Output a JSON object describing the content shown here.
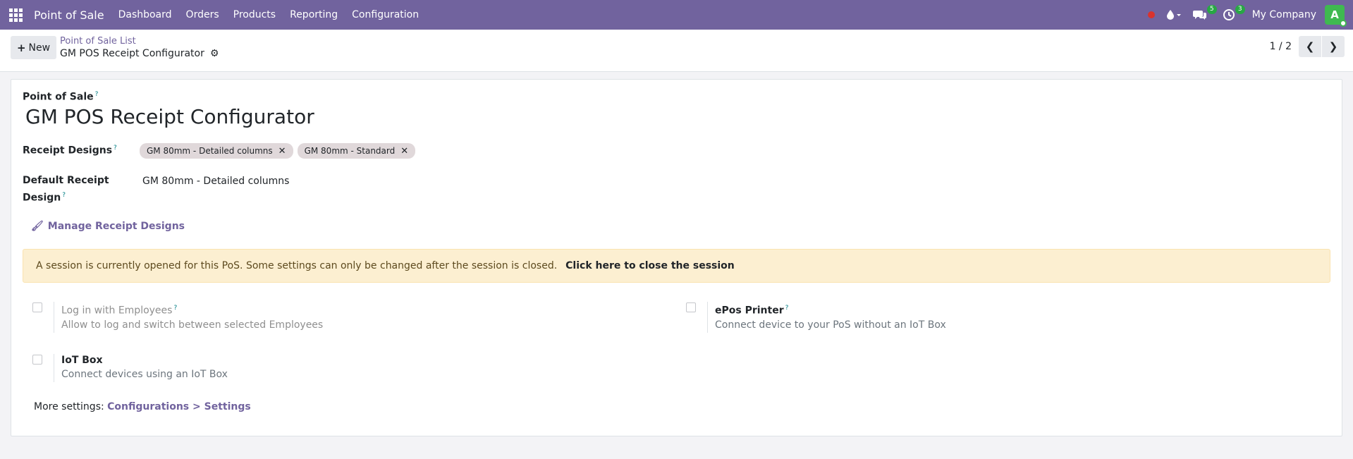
{
  "navbar": {
    "app_title": "Point of Sale",
    "menu": [
      "Dashboard",
      "Orders",
      "Products",
      "Reporting",
      "Configuration"
    ],
    "messages_count": "5",
    "activities_count": "3",
    "company": "My Company",
    "avatar_letter": "A",
    "colors": {
      "navbar_bg": "#71639e",
      "avatar_bg": "#3fb950",
      "badge": "#28a745",
      "record_dot": "#d9332e"
    }
  },
  "control_panel": {
    "new_label": "New",
    "breadcrumb_parent": "Point of Sale List",
    "breadcrumb_current": "GM POS Receipt Configurator",
    "pager_value": "1 / 2"
  },
  "form": {
    "name_label": "Point of Sale",
    "name_value": "GM POS Receipt Configurator",
    "receipt_designs_label": "Receipt Designs",
    "receipt_designs": [
      "GM 80mm - Detailed columns",
      "GM 80mm - Standard"
    ],
    "default_design_label_line1": "Default Receipt",
    "default_design_label_line2": "Design",
    "default_design_value": "GM 80mm - Detailed columns",
    "manage_link": "Manage Receipt Designs",
    "alert_text": "A session is currently opened for this PoS. Some settings can only be changed after the session is closed.",
    "alert_link": "Click here to close the session",
    "settings": {
      "employees_title": "Log in with Employees",
      "employees_desc": "Allow to log and switch between selected Employees",
      "epos_title": "ePos Printer",
      "epos_desc": "Connect device to your PoS without an IoT Box",
      "iot_title": "IoT Box",
      "iot_desc": "Connect devices using an IoT Box"
    },
    "more_settings_prefix": "More settings:",
    "more_settings_link": "Configurations > Settings",
    "help_mark": "?"
  }
}
